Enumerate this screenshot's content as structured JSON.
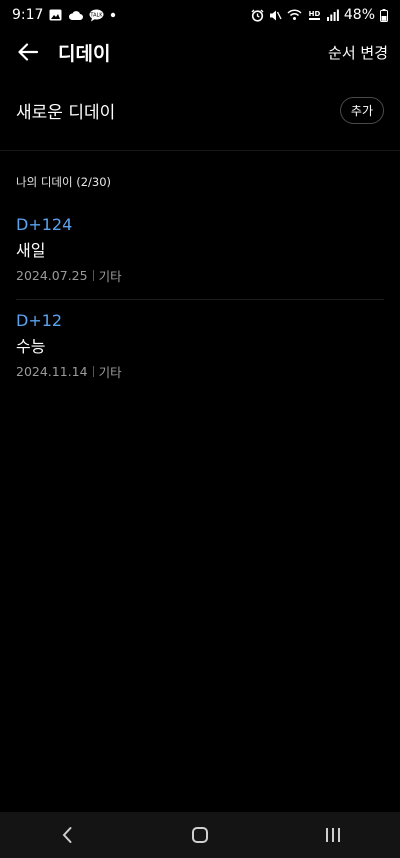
{
  "status_bar": {
    "time": "9:17",
    "battery_percent": "48%",
    "left_icons": [
      "gallery-icon",
      "cloud-icon",
      "chat-bubble-icon",
      "dot-icon"
    ],
    "right_icons": [
      "alarm-icon",
      "mute-icon",
      "wifi-icon",
      "hd-volte-icon",
      "signal-icon",
      "battery-icon"
    ]
  },
  "app_bar": {
    "title": "디데이",
    "reorder_label": "순서 변경"
  },
  "new_dday": {
    "label": "새로운 디데이",
    "add_label": "추가"
  },
  "section": {
    "header": "나의 디데이 (2/30)"
  },
  "items": [
    {
      "dday": "D+124",
      "title": "새일",
      "date": "2024.07.25",
      "category": "기타"
    },
    {
      "dday": "D+12",
      "title": "수능",
      "date": "2024.11.14",
      "category": "기타"
    }
  ],
  "colors": {
    "background": "#000000",
    "accent": "#5aa3f0",
    "secondary_text": "#9a9a9a",
    "nav_bar": "#141414"
  }
}
